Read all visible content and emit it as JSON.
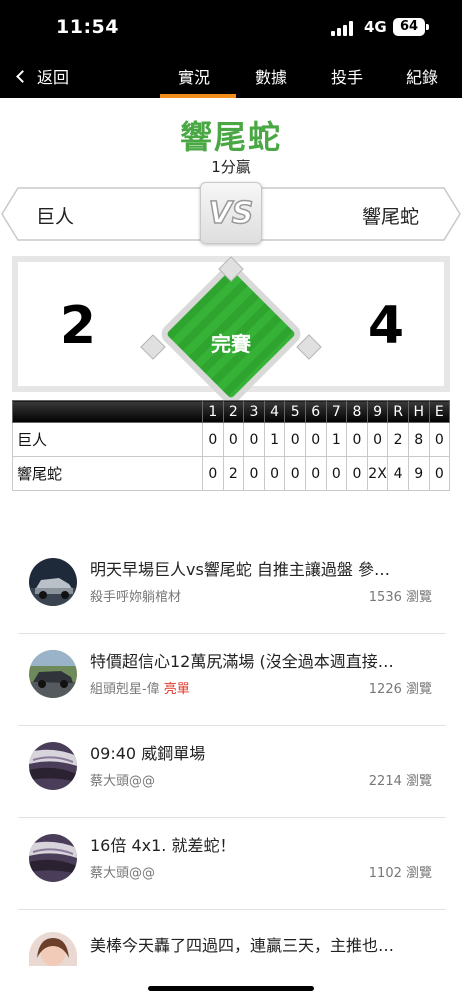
{
  "status_bar": {
    "time": "11:54",
    "network": "4G",
    "battery": "64"
  },
  "nav": {
    "back_label": "返回",
    "tabs": [
      {
        "label": "實況",
        "active": true
      },
      {
        "label": "數據",
        "active": false
      },
      {
        "label": "投手",
        "active": false
      },
      {
        "label": "紀錄",
        "active": false
      }
    ]
  },
  "game": {
    "winner": "響尾蛇",
    "margin": "1分贏",
    "vs_label": "VS",
    "away_team": "巨人",
    "home_team": "響尾蛇",
    "away_score": "2",
    "home_score": "4",
    "status": "完賽"
  },
  "linescore": {
    "headers": [
      "1",
      "2",
      "3",
      "4",
      "5",
      "6",
      "7",
      "8",
      "9",
      "R",
      "H",
      "E"
    ],
    "rows": [
      {
        "team": "巨人",
        "cells": [
          "0",
          "0",
          "0",
          "1",
          "0",
          "0",
          "1",
          "0",
          "0",
          "2",
          "8",
          "0"
        ]
      },
      {
        "team": "響尾蛇",
        "cells": [
          "0",
          "2",
          "0",
          "0",
          "0",
          "0",
          "0",
          "0",
          "2X",
          "4",
          "9",
          "0"
        ]
      }
    ]
  },
  "posts": [
    {
      "title": "明天早場巨人vs響尾蛇  自推主讓過盤  參…",
      "author": "殺手呼妳躺棺材",
      "tag": "",
      "views": "1536 瀏覽",
      "avatar": "car-avatar"
    },
    {
      "title": "特價超信心12萬尻滿場 (沒全過本週直接…",
      "author": "組頭剋星-偉",
      "tag": "亮單",
      "views": "1226 瀏覽",
      "avatar": "car-road-avatar"
    },
    {
      "title": "09:40 威鋼單場",
      "author": "蔡大頭@@",
      "tag": "",
      "views": "2214 瀏覽",
      "avatar": "tyre-avatar"
    },
    {
      "title": "16倍 4x1. 就差蛇！",
      "author": "蔡大頭@@",
      "tag": "",
      "views": "1102 瀏覽",
      "avatar": "tyre-avatar"
    },
    {
      "title": "美棒今天轟了四過四，連贏三天，主推也…",
      "author": "",
      "tag": "",
      "views": "",
      "avatar": "person-avatar"
    }
  ],
  "colors": {
    "accent": "#f28c1a",
    "winner": "#4aa844",
    "field": "#2fa52f",
    "tag": "#e0352b"
  }
}
